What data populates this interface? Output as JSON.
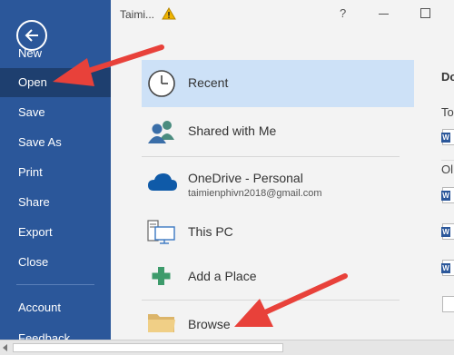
{
  "window": {
    "title": "Taimi...",
    "help": "?",
    "warning_icon": "warning-icon"
  },
  "sidebar": {
    "back_icon": "back-arrow-icon",
    "items": [
      {
        "label": "New"
      },
      {
        "label": "Open",
        "active": true
      },
      {
        "label": "Save"
      },
      {
        "label": "Save As"
      },
      {
        "label": "Print"
      },
      {
        "label": "Share"
      },
      {
        "label": "Export"
      },
      {
        "label": "Close"
      },
      {
        "label": "Account"
      },
      {
        "label": "Feedback"
      }
    ]
  },
  "locations": [
    {
      "label": "Recent",
      "icon": "clock-icon",
      "selected": true
    },
    {
      "label": "Shared with Me",
      "icon": "people-icon"
    },
    {
      "label": "OneDrive - Personal",
      "sub": "taimienphivn2018@gmail.com",
      "icon": "cloud-icon"
    },
    {
      "label": "This PC",
      "icon": "computer-icon"
    },
    {
      "label": "Add a Place",
      "icon": "plus-icon"
    },
    {
      "label": "Browse",
      "icon": "folder-icon"
    }
  ],
  "right_panel": {
    "heading": "Do",
    "group1": "To",
    "group2": "Ol"
  },
  "colors": {
    "sidebar_bg": "#2b579a",
    "active_item": "#1e3f6f",
    "selected_location": "#cde1f7",
    "annotation_arrow": "#e8413a"
  }
}
